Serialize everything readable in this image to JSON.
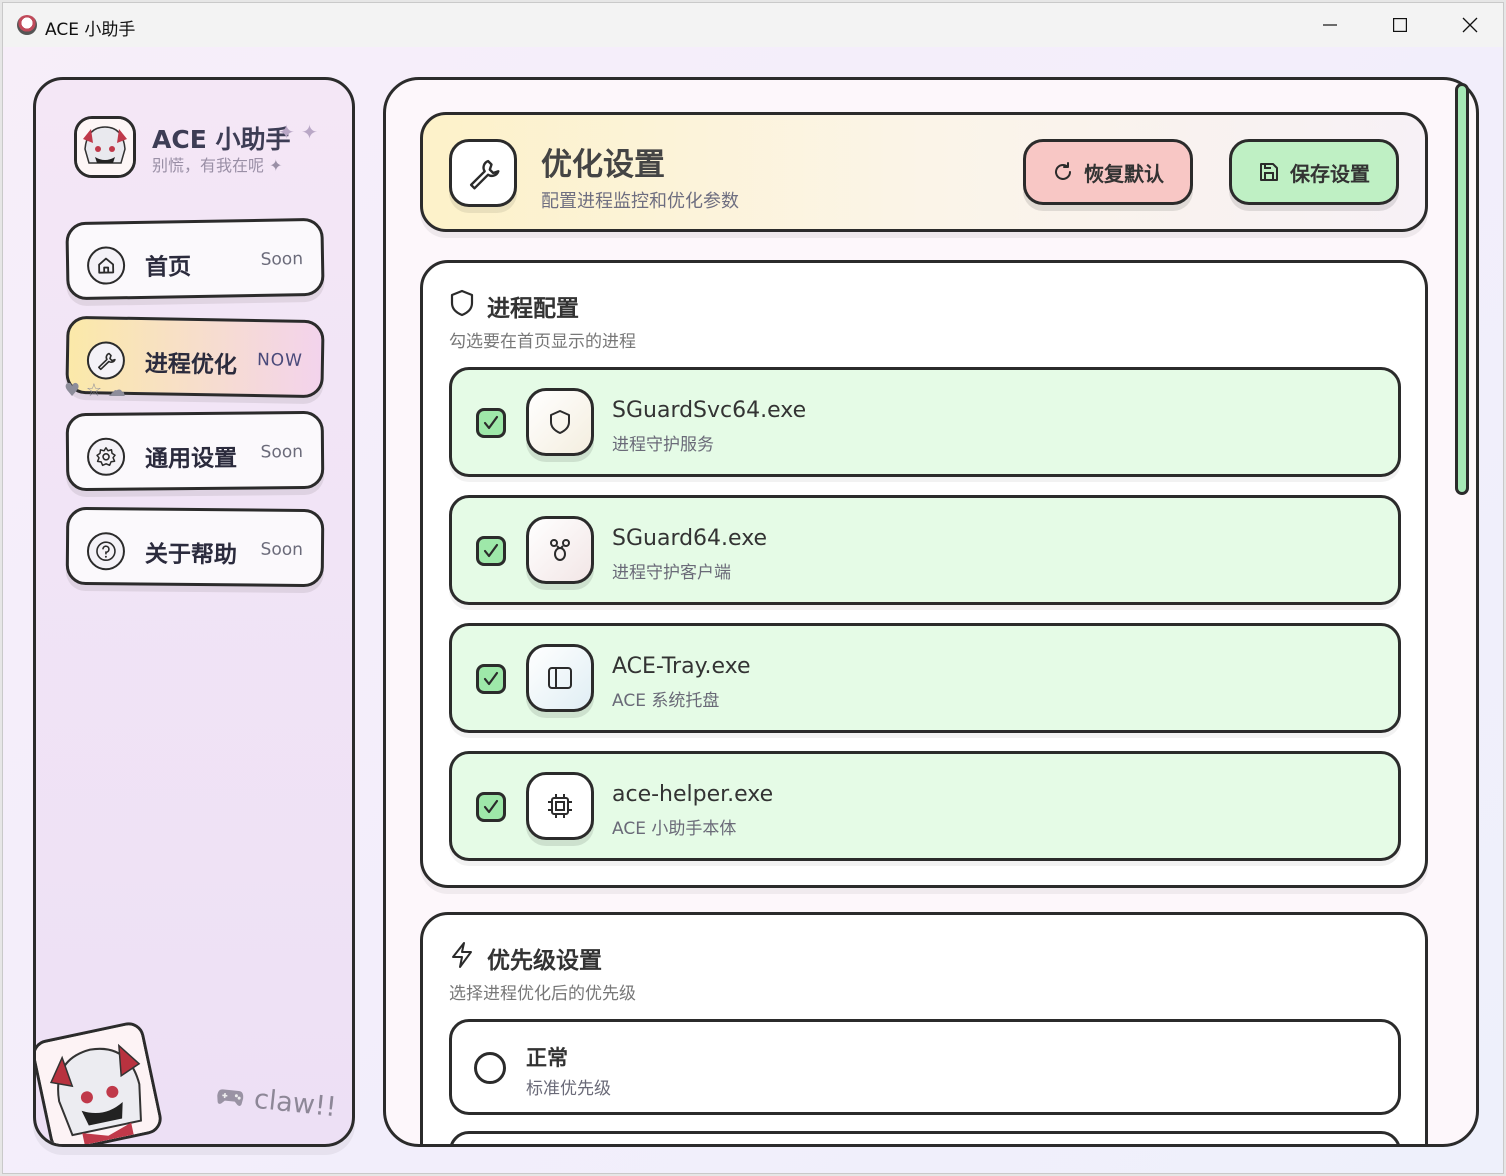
{
  "window": {
    "title": "ACE 小助手",
    "controls": {
      "minimize": "minimize-icon",
      "maximize": "maximize-icon",
      "close": "close-icon"
    }
  },
  "sidebar": {
    "brand_title": "ACE 小助手",
    "brand_sparkle": "✦ ✦",
    "brand_subtitle": "别慌，有我在呢 ✦",
    "nav": [
      {
        "label": "首页",
        "badge": "Soon",
        "icon": "home-icon"
      },
      {
        "label": "进程优化",
        "badge": "NOW",
        "icon": "wrench-icon",
        "active": true
      },
      {
        "label": "通用设置",
        "badge": "Soon",
        "icon": "gear-icon"
      },
      {
        "label": "关于帮助",
        "badge": "Soon",
        "icon": "help-icon"
      }
    ],
    "footer_text": "claw!!"
  },
  "header": {
    "title": "优化设置",
    "subtitle": "配置进程监控和优化参数",
    "reset_label": "恢复默认",
    "save_label": "保存设置"
  },
  "process_section": {
    "title": "进程配置",
    "subtitle": "勾选要在首页显示的进程",
    "items": [
      {
        "name": "SGuardSvc64.exe",
        "desc": "进程守护服务",
        "checked": true,
        "icon": "shield-icon"
      },
      {
        "name": "SGuard64.exe",
        "desc": "进程守护客户端",
        "checked": true,
        "icon": "paw-icon"
      },
      {
        "name": "ACE-Tray.exe",
        "desc": "ACE 系统托盘",
        "checked": true,
        "icon": "panel-icon"
      },
      {
        "name": "ace-helper.exe",
        "desc": "ACE 小助手本体",
        "checked": true,
        "icon": "chip-icon"
      }
    ]
  },
  "priority_section": {
    "title": "优先级设置",
    "subtitle": "选择进程优化后的优先级",
    "items": [
      {
        "name": "正常",
        "desc": "标准优先级",
        "selected": false
      }
    ]
  },
  "colors": {
    "accent_green": "#bff0c4",
    "accent_red": "#f8c7c5",
    "item_green": "#e5fbe6",
    "active_nav": "#fbe9a9",
    "border": "#2b2b2b"
  }
}
